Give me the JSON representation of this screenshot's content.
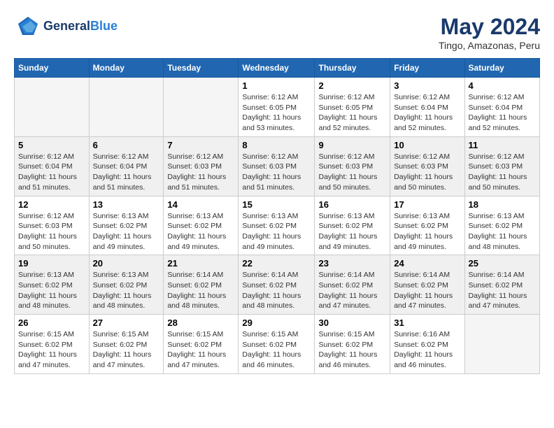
{
  "header": {
    "logo_line1": "General",
    "logo_line2": "Blue",
    "title": "May 2024",
    "subtitle": "Tingo, Amazonas, Peru"
  },
  "days_of_week": [
    "Sunday",
    "Monday",
    "Tuesday",
    "Wednesday",
    "Thursday",
    "Friday",
    "Saturday"
  ],
  "weeks": [
    [
      {
        "day": "",
        "info": ""
      },
      {
        "day": "",
        "info": ""
      },
      {
        "day": "",
        "info": ""
      },
      {
        "day": "1",
        "info": "Sunrise: 6:12 AM\nSunset: 6:05 PM\nDaylight: 11 hours and 53 minutes."
      },
      {
        "day": "2",
        "info": "Sunrise: 6:12 AM\nSunset: 6:05 PM\nDaylight: 11 hours and 52 minutes."
      },
      {
        "day": "3",
        "info": "Sunrise: 6:12 AM\nSunset: 6:04 PM\nDaylight: 11 hours and 52 minutes."
      },
      {
        "day": "4",
        "info": "Sunrise: 6:12 AM\nSunset: 6:04 PM\nDaylight: 11 hours and 52 minutes."
      }
    ],
    [
      {
        "day": "5",
        "info": "Sunrise: 6:12 AM\nSunset: 6:04 PM\nDaylight: 11 hours and 51 minutes."
      },
      {
        "day": "6",
        "info": "Sunrise: 6:12 AM\nSunset: 6:04 PM\nDaylight: 11 hours and 51 minutes."
      },
      {
        "day": "7",
        "info": "Sunrise: 6:12 AM\nSunset: 6:03 PM\nDaylight: 11 hours and 51 minutes."
      },
      {
        "day": "8",
        "info": "Sunrise: 6:12 AM\nSunset: 6:03 PM\nDaylight: 11 hours and 51 minutes."
      },
      {
        "day": "9",
        "info": "Sunrise: 6:12 AM\nSunset: 6:03 PM\nDaylight: 11 hours and 50 minutes."
      },
      {
        "day": "10",
        "info": "Sunrise: 6:12 AM\nSunset: 6:03 PM\nDaylight: 11 hours and 50 minutes."
      },
      {
        "day": "11",
        "info": "Sunrise: 6:12 AM\nSunset: 6:03 PM\nDaylight: 11 hours and 50 minutes."
      }
    ],
    [
      {
        "day": "12",
        "info": "Sunrise: 6:12 AM\nSunset: 6:03 PM\nDaylight: 11 hours and 50 minutes."
      },
      {
        "day": "13",
        "info": "Sunrise: 6:13 AM\nSunset: 6:02 PM\nDaylight: 11 hours and 49 minutes."
      },
      {
        "day": "14",
        "info": "Sunrise: 6:13 AM\nSunset: 6:02 PM\nDaylight: 11 hours and 49 minutes."
      },
      {
        "day": "15",
        "info": "Sunrise: 6:13 AM\nSunset: 6:02 PM\nDaylight: 11 hours and 49 minutes."
      },
      {
        "day": "16",
        "info": "Sunrise: 6:13 AM\nSunset: 6:02 PM\nDaylight: 11 hours and 49 minutes."
      },
      {
        "day": "17",
        "info": "Sunrise: 6:13 AM\nSunset: 6:02 PM\nDaylight: 11 hours and 49 minutes."
      },
      {
        "day": "18",
        "info": "Sunrise: 6:13 AM\nSunset: 6:02 PM\nDaylight: 11 hours and 48 minutes."
      }
    ],
    [
      {
        "day": "19",
        "info": "Sunrise: 6:13 AM\nSunset: 6:02 PM\nDaylight: 11 hours and 48 minutes."
      },
      {
        "day": "20",
        "info": "Sunrise: 6:13 AM\nSunset: 6:02 PM\nDaylight: 11 hours and 48 minutes."
      },
      {
        "day": "21",
        "info": "Sunrise: 6:14 AM\nSunset: 6:02 PM\nDaylight: 11 hours and 48 minutes."
      },
      {
        "day": "22",
        "info": "Sunrise: 6:14 AM\nSunset: 6:02 PM\nDaylight: 11 hours and 48 minutes."
      },
      {
        "day": "23",
        "info": "Sunrise: 6:14 AM\nSunset: 6:02 PM\nDaylight: 11 hours and 47 minutes."
      },
      {
        "day": "24",
        "info": "Sunrise: 6:14 AM\nSunset: 6:02 PM\nDaylight: 11 hours and 47 minutes."
      },
      {
        "day": "25",
        "info": "Sunrise: 6:14 AM\nSunset: 6:02 PM\nDaylight: 11 hours and 47 minutes."
      }
    ],
    [
      {
        "day": "26",
        "info": "Sunrise: 6:15 AM\nSunset: 6:02 PM\nDaylight: 11 hours and 47 minutes."
      },
      {
        "day": "27",
        "info": "Sunrise: 6:15 AM\nSunset: 6:02 PM\nDaylight: 11 hours and 47 minutes."
      },
      {
        "day": "28",
        "info": "Sunrise: 6:15 AM\nSunset: 6:02 PM\nDaylight: 11 hours and 47 minutes."
      },
      {
        "day": "29",
        "info": "Sunrise: 6:15 AM\nSunset: 6:02 PM\nDaylight: 11 hours and 46 minutes."
      },
      {
        "day": "30",
        "info": "Sunrise: 6:15 AM\nSunset: 6:02 PM\nDaylight: 11 hours and 46 minutes."
      },
      {
        "day": "31",
        "info": "Sunrise: 6:16 AM\nSunset: 6:02 PM\nDaylight: 11 hours and 46 minutes."
      },
      {
        "day": "",
        "info": ""
      }
    ]
  ]
}
